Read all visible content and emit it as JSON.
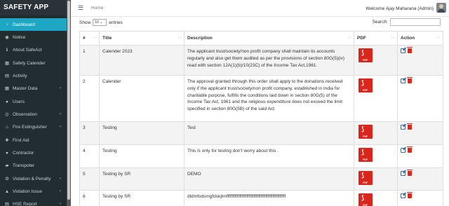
{
  "app": {
    "title": "SAFETY APP"
  },
  "sidebar": {
    "items": [
      {
        "label": "Dashboard",
        "icon": "dashboard-icon",
        "glyph": "◔",
        "active": true,
        "chevron": false
      },
      {
        "label": "Notice",
        "icon": "bell-icon",
        "glyph": "◉",
        "active": false,
        "chevron": false
      },
      {
        "label": "About SafeAct",
        "icon": "info-icon",
        "glyph": "ℹ",
        "active": false,
        "chevron": false
      },
      {
        "label": "Safety Calender",
        "icon": "calendar-icon",
        "glyph": "▦",
        "active": false,
        "chevron": false
      },
      {
        "label": "Activity",
        "icon": "activity-icon",
        "glyph": "▤",
        "active": false,
        "chevron": false
      },
      {
        "label": "Master Data",
        "icon": "table-icon",
        "glyph": "▦",
        "active": false,
        "chevron": true
      },
      {
        "label": "Users",
        "icon": "users-icon",
        "glyph": "●",
        "active": false,
        "chevron": false
      },
      {
        "label": "Observation",
        "icon": "eye-icon",
        "glyph": "◎",
        "active": false,
        "chevron": true
      },
      {
        "label": "Fire Extinguisher",
        "icon": "fire-icon",
        "glyph": "♨",
        "active": false,
        "chevron": true
      },
      {
        "label": "First Aid",
        "icon": "first-aid-icon",
        "glyph": "✚",
        "active": false,
        "chevron": false
      },
      {
        "label": "Contractor",
        "icon": "user-icon",
        "glyph": "●",
        "active": false,
        "chevron": false
      },
      {
        "label": "Transpoter",
        "icon": "truck-icon",
        "glyph": "▰",
        "active": false,
        "chevron": false
      },
      {
        "label": "Violation & Penalty",
        "icon": "gear-icon",
        "glyph": "⚙",
        "active": false,
        "chevron": true
      },
      {
        "label": "Violation Issue",
        "icon": "warning-icon",
        "glyph": "▲",
        "active": false,
        "chevron": true
      },
      {
        "label": "HSE Report",
        "icon": "report-icon",
        "glyph": "▤",
        "active": false,
        "chevron": true
      }
    ]
  },
  "header": {
    "menu_icon": "☰",
    "breadcrumb": "Home",
    "welcome": "Welcome Ajay Maharana (Admin)"
  },
  "table_controls": {
    "show_label": "Show",
    "page_size": "10",
    "entries_label": "entries",
    "search_label": "Search:"
  },
  "table": {
    "columns": [
      "#",
      "Title",
      "Description",
      "PDF",
      "Action"
    ],
    "rows": [
      {
        "num": "1",
        "title": "Calender 2023",
        "description": "The applicant trust/society/non profit company shall maintain its accounts regularly and also get them audited as per the provisions of section 80G(5)(iv) read with section 12A(1)(b)/10(23C) of the Income Tax Act,1961."
      },
      {
        "num": "2",
        "title": "Calender",
        "description": "The approval granted through this order shall apply to the donations received only if the applicant trust/society/non profit company, established in India for charitable purpose, fulfills the conditions laid down in section 80G(5) of the Income Tax Act, 1961 and the religious expenditure does not exceed the limit specified in section 80G(5B) of the said Act."
      },
      {
        "num": "3",
        "title": "Testing",
        "description": "Test"
      },
      {
        "num": "4",
        "title": "Testing",
        "description": "This is only for testing don't worry about this ."
      },
      {
        "num": "5",
        "title": "Testing by SR",
        "description": "DEMO"
      },
      {
        "num": "6",
        "title": "Testing by SR",
        "description": "dldmfodsmgfdskjlmffffffffffffffffffffffffffffffffffffffffffffffffff"
      }
    ],
    "pdf_label": "PDF"
  },
  "colors": {
    "sidebar_bg": "#222d32",
    "active_item": "#1ea7c5",
    "pdf_red": "#d9251c",
    "edit_blue": "#1e72c7",
    "delete_red": "#e0261c"
  }
}
